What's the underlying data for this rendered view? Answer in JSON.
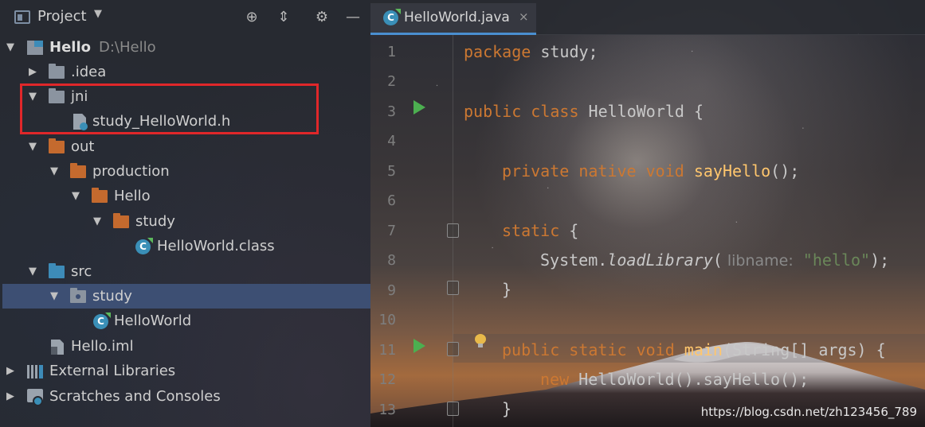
{
  "project_panel": {
    "title": "Project",
    "tree": [
      {
        "label": "Hello",
        "suffix": "D:\\Hello"
      },
      {
        "label": ".idea"
      },
      {
        "label": "jni"
      },
      {
        "label": "study_HelloWorld.h"
      },
      {
        "label": "out"
      },
      {
        "label": "production"
      },
      {
        "label": "Hello"
      },
      {
        "label": "study"
      },
      {
        "label": "HelloWorld.class"
      },
      {
        "label": "src"
      },
      {
        "label": "study"
      },
      {
        "label": "HelloWorld"
      },
      {
        "label": "Hello.iml"
      },
      {
        "label": "External Libraries"
      },
      {
        "label": "Scratches and Consoles"
      }
    ]
  },
  "editor": {
    "tab": {
      "label": "HelloWorld.java",
      "close": "×"
    },
    "line_numbers": [
      "1",
      "2",
      "3",
      "4",
      "5",
      "6",
      "7",
      "8",
      "9",
      "10",
      "11",
      "12",
      "13"
    ],
    "code": {
      "l1_kw": "package",
      "l1_rest": " study;",
      "l3_kw": "public class",
      "l3_rest": " HelloWorld {",
      "l5_kw": "private native void",
      "l5_fn": "sayHello",
      "l5_rest": "();",
      "l7_kw": "static",
      "l7_rest": " {",
      "l8_obj": "System.",
      "l8_fn": "loadLibrary",
      "l8_open": "(",
      "l8_hint": " libname:",
      "l8_str": " \"hello\"",
      "l8_close": ");",
      "l9": "}",
      "l11_kw": "public static void",
      "l11_fn": "main",
      "l11_rest": "(String[] args) {",
      "l12_kw": "new",
      "l12_rest": " HelloWorld().sayHello();",
      "l13": "}"
    }
  },
  "watermark": "https://blog.csdn.net/zh123456_789"
}
